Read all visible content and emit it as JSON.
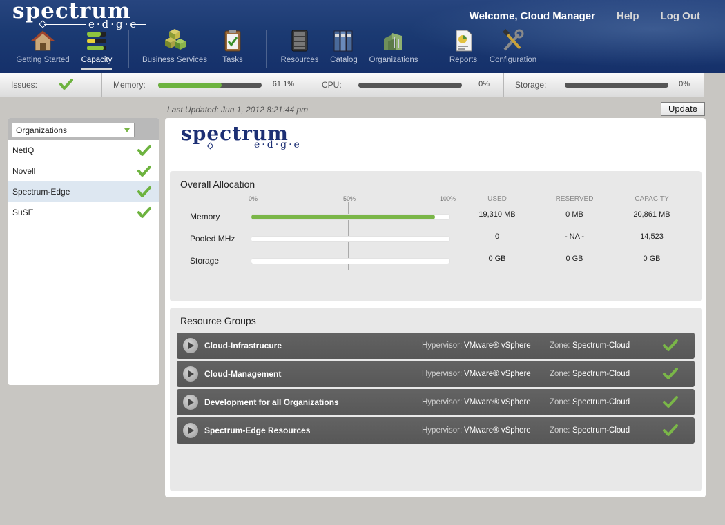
{
  "app": {
    "logo_main": "spectrum",
    "logo_sub": "e·d·g·e"
  },
  "header": {
    "welcome": "Welcome, Cloud Manager",
    "help": "Help",
    "logout": "Log Out"
  },
  "nav": {
    "items": [
      {
        "label": "Getting Started",
        "icon": "house-icon"
      },
      {
        "label": "Capacity",
        "icon": "capacity-bars-icon",
        "active": true
      },
      {
        "label": "Business Services",
        "icon": "cubes-icon"
      },
      {
        "label": "Tasks",
        "icon": "clipboard-icon"
      },
      {
        "label": "Resources",
        "icon": "server-icon"
      },
      {
        "label": "Catalog",
        "icon": "binders-icon"
      },
      {
        "label": "Organizations",
        "icon": "buildings-icon"
      },
      {
        "label": "Reports",
        "icon": "report-icon"
      },
      {
        "label": "Configuration",
        "icon": "tools-icon"
      }
    ]
  },
  "status": {
    "issues_label": "Issues:",
    "memory_label": "Memory:",
    "memory_pct": "61.1%",
    "memory_fraction": 0.611,
    "cpu_label": "CPU:",
    "cpu_pct": "0%",
    "cpu_fraction": 0,
    "storage_label": "Storage:",
    "storage_pct": "0%",
    "storage_fraction": 0
  },
  "sidebar": {
    "dropdown_value": "Organizations",
    "items": [
      {
        "name": "NetIQ",
        "status": "ok"
      },
      {
        "name": "Novell",
        "status": "ok"
      },
      {
        "name": "Spectrum-Edge",
        "status": "ok",
        "selected": true
      },
      {
        "name": "SuSE",
        "status": "ok"
      }
    ]
  },
  "main": {
    "last_updated": "Last Updated: Jun 1, 2012 8:21:44 pm",
    "update_button": "Update",
    "allocation": {
      "title": "Overall Allocation",
      "ticks": [
        "0%",
        "50%",
        "100%"
      ],
      "columns": [
        "USED",
        "RESERVED",
        "CAPACITY"
      ],
      "rows": [
        {
          "label": "Memory",
          "fraction": 0.926,
          "used": "19,310 MB",
          "reserved": "0 MB",
          "capacity": "20,861 MB"
        },
        {
          "label": "Pooled MHz",
          "fraction": 0,
          "used": "0",
          "reserved": "- NA -",
          "capacity": "14,523"
        },
        {
          "label": "Storage",
          "fraction": 0,
          "used": "0 GB",
          "reserved": "0 GB",
          "capacity": "0 GB"
        }
      ]
    },
    "resource_groups": {
      "title": "Resource Groups",
      "hypervisor_label": "Hypervisor:",
      "zone_label": "Zone:",
      "rows": [
        {
          "name": "Cloud-Infrastrucure",
          "hypervisor": "VMware® vSphere",
          "zone": "Spectrum-Cloud",
          "status": "ok"
        },
        {
          "name": "Cloud-Management",
          "hypervisor": "VMware® vSphere",
          "zone": "Spectrum-Cloud",
          "status": "ok"
        },
        {
          "name": "Development for all Organizations",
          "hypervisor": "VMware® vSphere",
          "zone": "Spectrum-Cloud",
          "status": "ok"
        },
        {
          "name": "Spectrum-Edge Resources",
          "hypervisor": "VMware® vSphere",
          "zone": "Spectrum-Cloud",
          "status": "ok"
        }
      ]
    }
  },
  "colors": {
    "header_blue": "#1b3a72",
    "accent_green": "#7ab648",
    "group_row": "#5c5c5c",
    "panel_gray": "#e8e8e8"
  }
}
